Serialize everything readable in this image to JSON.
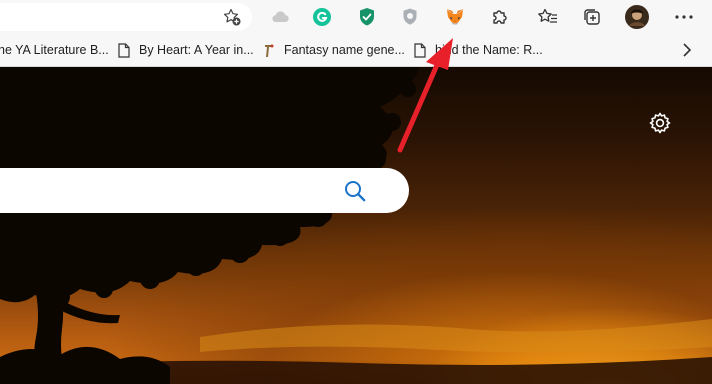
{
  "toolbar": {
    "favorites_star_icon": "star-add-icon",
    "extensions": [
      {
        "name": "cloud-icon",
        "color": "#c8c8c8"
      },
      {
        "name": "grammarly-icon",
        "color": "#15c39a"
      },
      {
        "name": "shield-check-icon",
        "color": "#1a9e6e"
      },
      {
        "name": "pocket-shield-icon",
        "color": "#9aa0a6"
      },
      {
        "name": "metamask-fox-icon",
        "color": "#e2761b"
      }
    ]
  },
  "bookmarks": {
    "items": [
      {
        "label": "he YA Literature B..."
      },
      {
        "label": "By Heart: A Year in..."
      },
      {
        "label": "Fantasy name gene..."
      },
      {
        "label": "hind the Name: R..."
      }
    ]
  },
  "search": {
    "placeholder": ""
  },
  "colors": {
    "accent_blue": "#1a73c8",
    "annotation_red": "#e8202a"
  }
}
